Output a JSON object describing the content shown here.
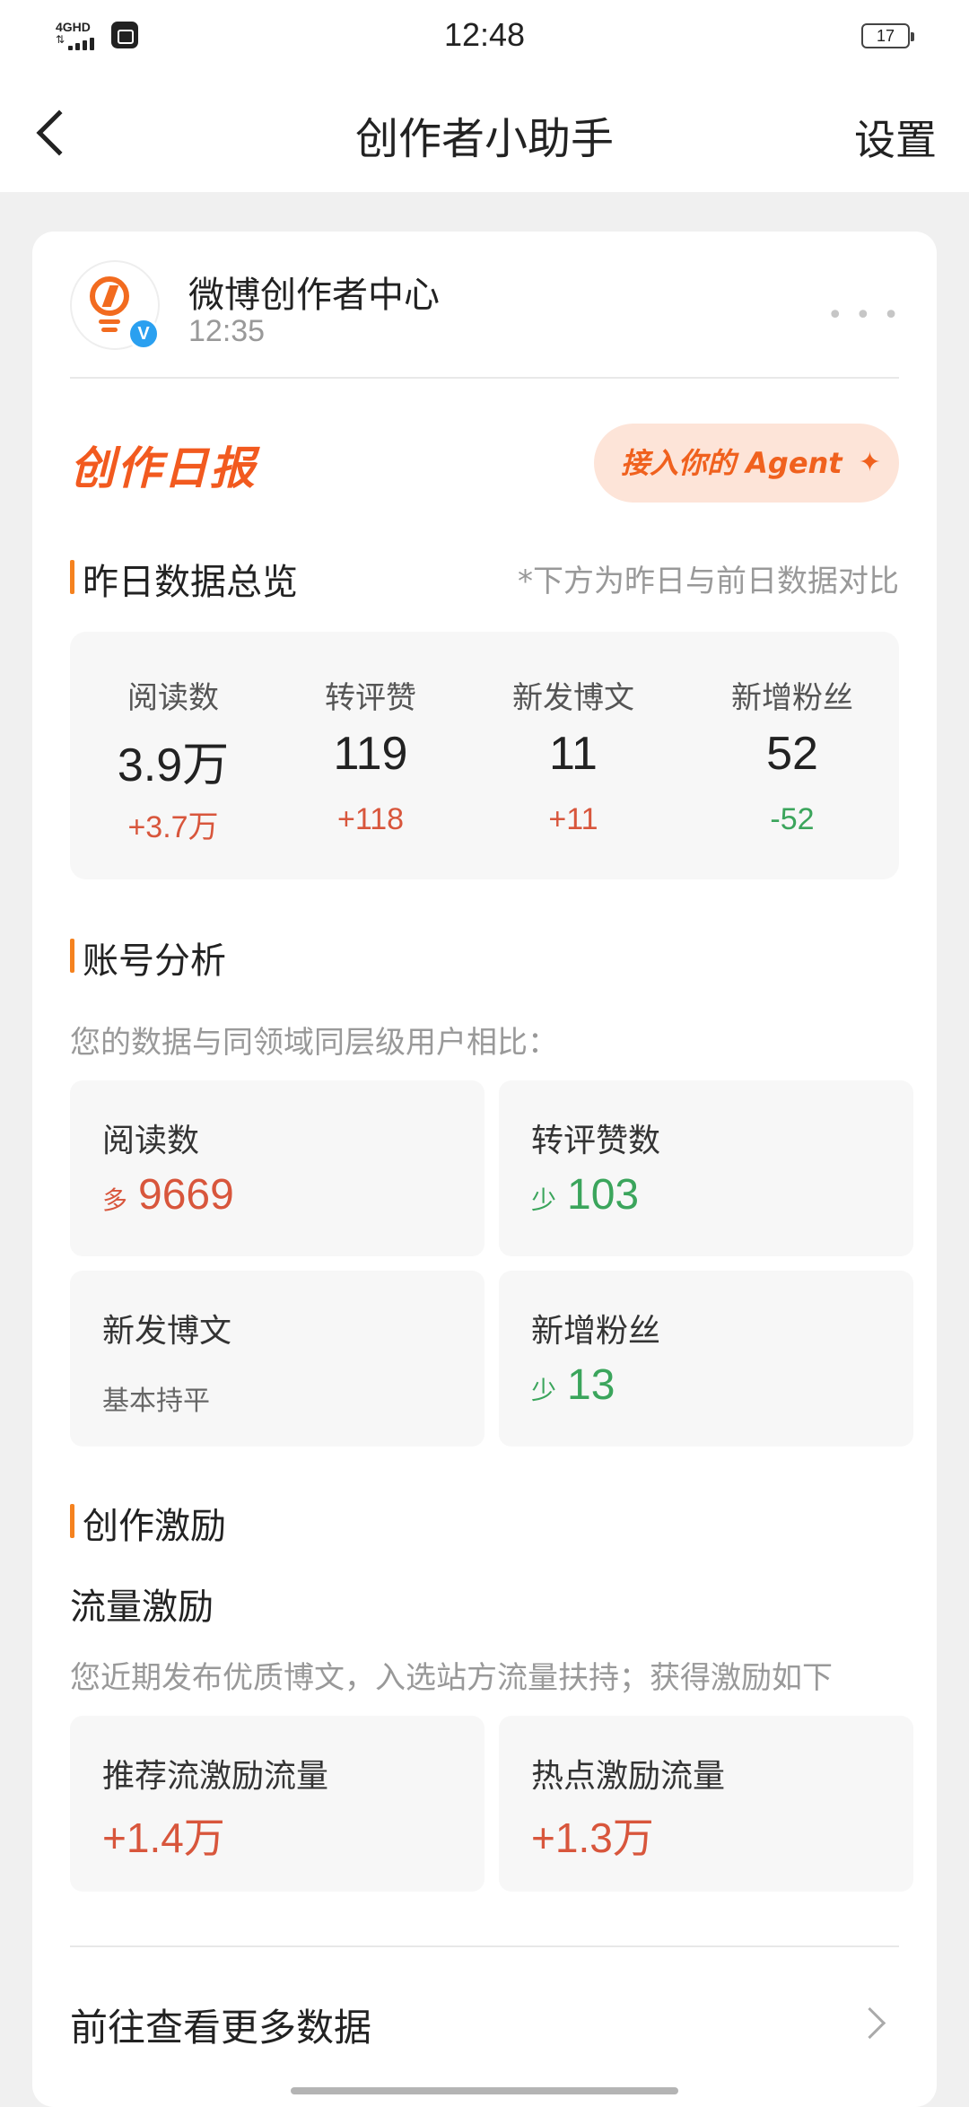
{
  "status_bar": {
    "network": "4GHD",
    "time": "12:48",
    "battery": "17"
  },
  "header": {
    "title": "创作者小助手",
    "settings_label": "设置"
  },
  "message": {
    "sender": "微博创作者中心",
    "time": "12:35",
    "verified_mark": "V"
  },
  "report": {
    "title": "创作日报",
    "agent_button": "接入你的 Agent",
    "agent_spark": "✦"
  },
  "overview": {
    "title": "昨日数据总览",
    "note": "*下方为昨日与前日数据对比",
    "stats": [
      {
        "label": "阅读数",
        "value": "3.9万",
        "delta": "+3.7万",
        "trend": "up"
      },
      {
        "label": "转评赞",
        "value": "119",
        "delta": "+118",
        "trend": "up"
      },
      {
        "label": "新发博文",
        "value": "11",
        "delta": "+11",
        "trend": "up"
      },
      {
        "label": "新增粉丝",
        "value": "52",
        "delta": "-52",
        "trend": "down"
      }
    ]
  },
  "analysis": {
    "title": "账号分析",
    "note": "您的数据与同领域同层级用户相比：",
    "tiles": [
      {
        "label": "阅读数",
        "tag": "多",
        "value": "9669"
      },
      {
        "label": "转评赞数",
        "tag": "少",
        "value": "103"
      },
      {
        "label": "新发博文",
        "flat": "基本持平"
      },
      {
        "label": "新增粉丝",
        "tag": "少",
        "value": "13"
      }
    ]
  },
  "incentive": {
    "title": "创作激励",
    "subtitle": "流量激励",
    "note": "您近期发布优质博文，入选站方流量扶持；获得激励如下",
    "tiles": [
      {
        "label": "推荐流激励流量",
        "value": "+1.4万"
      },
      {
        "label": "热点激励流量",
        "value": "+1.3万"
      }
    ]
  },
  "footer": {
    "more_link": "前往查看更多数据"
  },
  "colors": {
    "accent_orange": "#f25a1f",
    "increase": "#d8563c",
    "decrease": "#3ba55c"
  }
}
